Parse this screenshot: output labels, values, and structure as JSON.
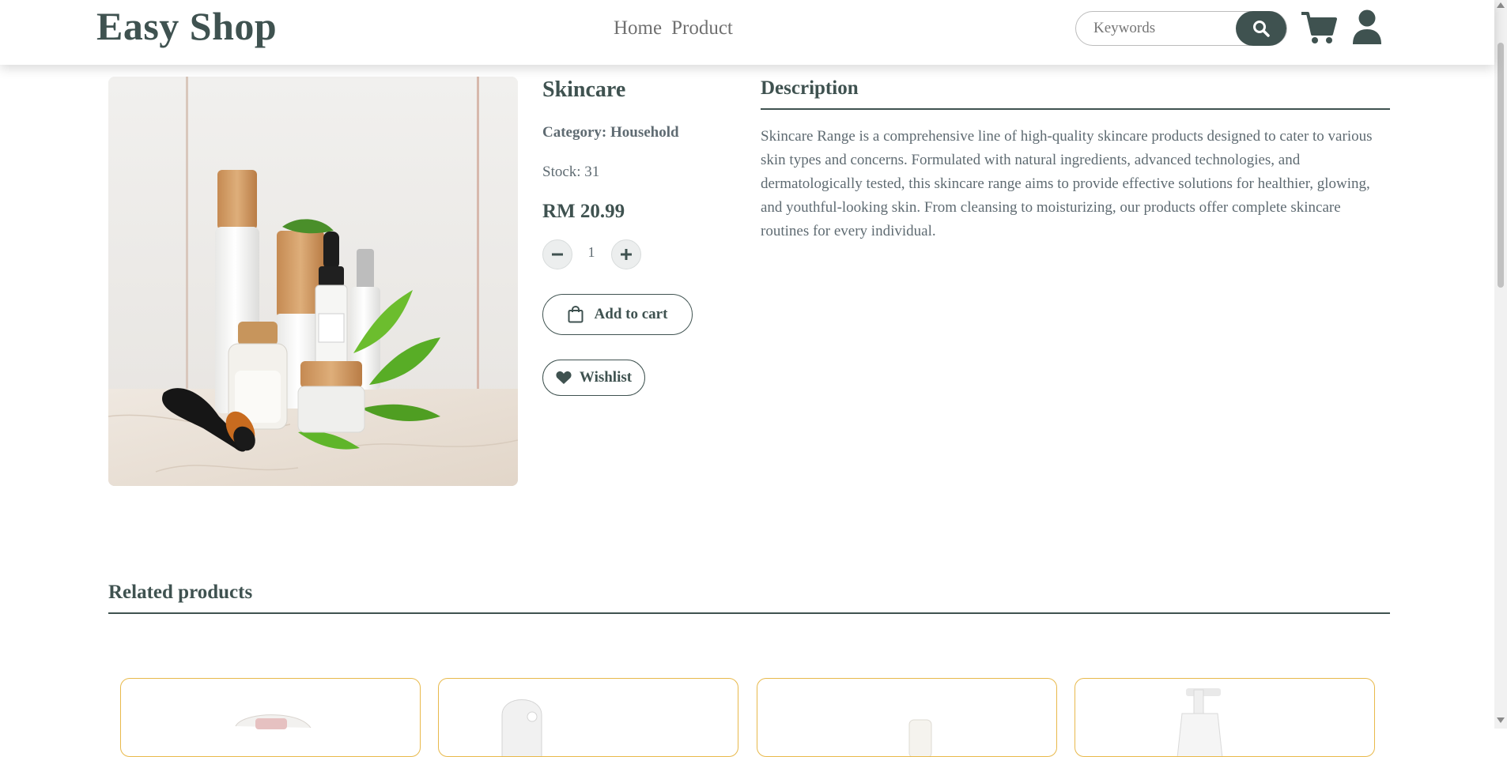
{
  "header": {
    "logo": "Easy Shop",
    "nav": [
      "Home",
      "Product"
    ],
    "search_placeholder": "Keywords",
    "icons": [
      "search-icon",
      "cart-icon",
      "user-icon"
    ],
    "accent_color": "#3f5250"
  },
  "product": {
    "name": "Skincare",
    "category": "Category: Household",
    "stock": "Stock: 31",
    "price": "RM 20.99",
    "quantity": "1",
    "add_to_cart_label": "Add to cart",
    "wishlist_label": "Wishlist"
  },
  "description": {
    "title": "Description",
    "text": "Skincare Range is a comprehensive line of high-quality skincare products designed to cater to various skin types and concerns. Formulated with natural ingredients, advanced technologies, and dermatologically tested, this skincare range aims to provide effective solutions for healthier, glowing, and youthful-looking skin. From cleansing to moisturizing, our products offer complete skincare routines for every individual."
  },
  "related": {
    "title": "Related products",
    "card_border_color": "#e8b94b"
  }
}
